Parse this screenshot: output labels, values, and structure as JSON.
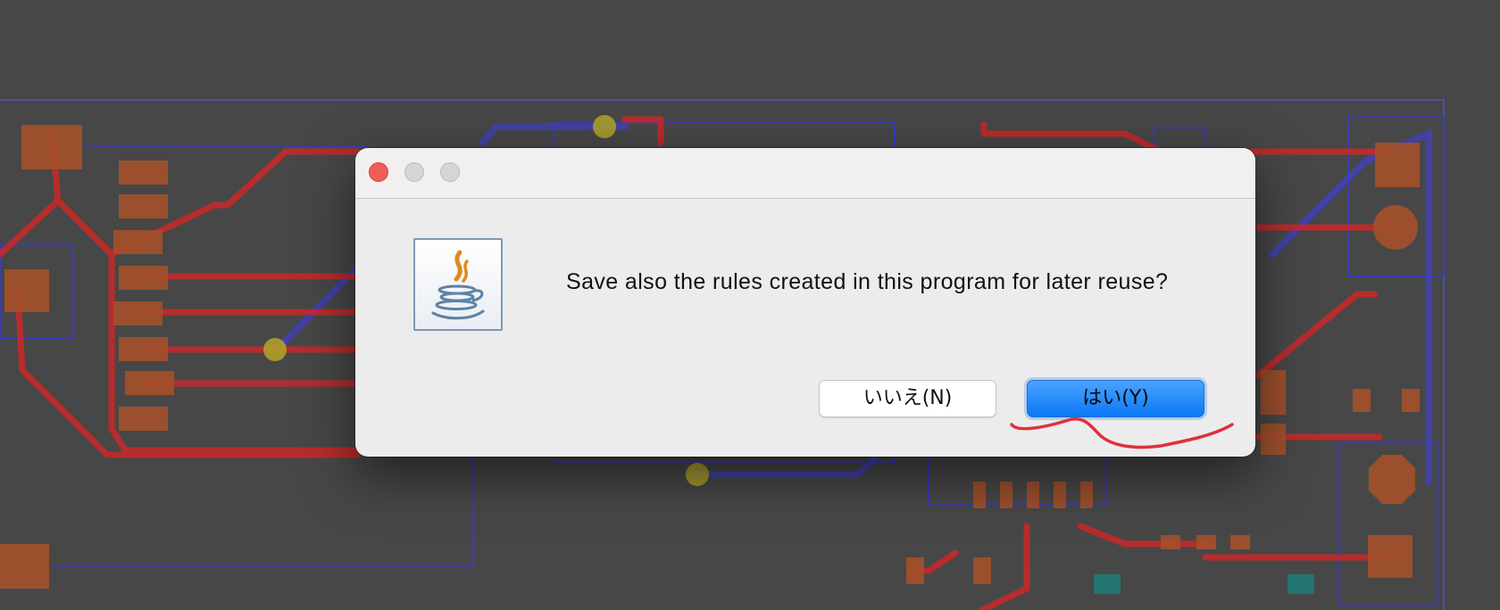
{
  "dialog": {
    "message": "Save also the rules created in this program for later reuse?",
    "window_controls": [
      "close",
      "minimize",
      "zoom"
    ],
    "icon": "java-cup-icon",
    "buttons": {
      "no_label": "いいえ(N)",
      "yes_label": "はい(Y)"
    },
    "default_button": "yes"
  },
  "colors": {
    "backdrop": "#474747",
    "trace_red": "#d62a2a",
    "trace_blue": "#3a3ad6",
    "pad_orange": "#a5502a",
    "via_yellow": "#b4a628",
    "accent_blue": "#0a78f5",
    "annotation_red": "#e0303a"
  }
}
